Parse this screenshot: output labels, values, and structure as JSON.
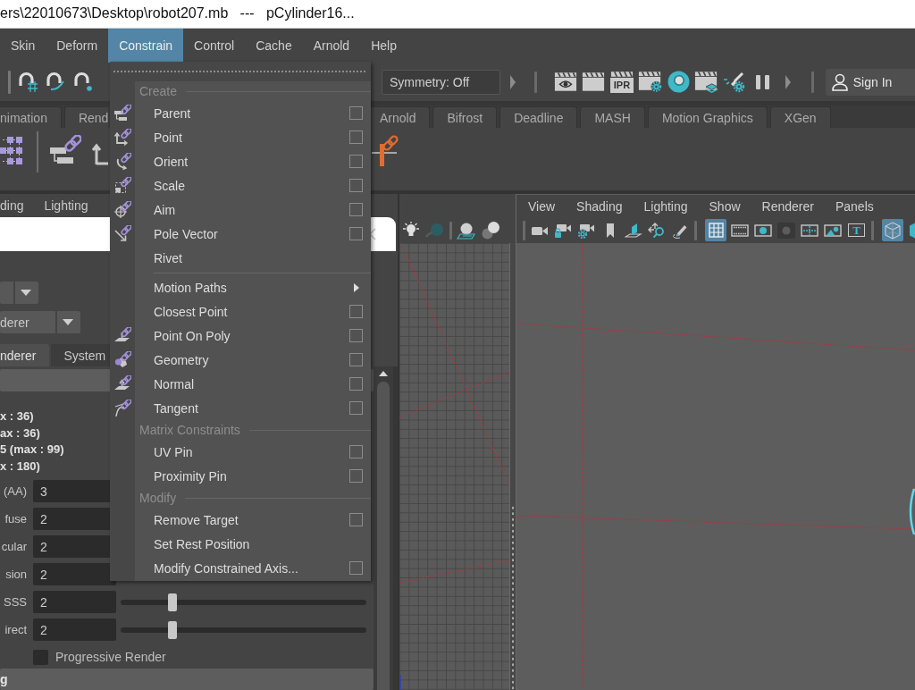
{
  "title_bar": {
    "title": "ers\\22010673\\Desktop\\robot207.mb   ---   pCylinder16..."
  },
  "menu_bar": [
    {
      "label": "Skin",
      "selected": false
    },
    {
      "label": "Deform",
      "selected": false
    },
    {
      "label": "Constrain",
      "selected": true
    },
    {
      "label": "Control",
      "selected": false
    },
    {
      "label": "Cache",
      "selected": false
    },
    {
      "label": "Arnold",
      "selected": false
    },
    {
      "label": "Help",
      "selected": false
    }
  ],
  "status_line": {
    "symmetry": "Symmetry: Off",
    "ipr_label": "IPR",
    "sign_in": "Sign In"
  },
  "shelf_tabs": [
    {
      "label": "nimation",
      "selected": false
    },
    {
      "label": "Rend",
      "selected": false
    },
    {
      "label": "Arnold",
      "selected": false
    },
    {
      "label": "Bifrost",
      "selected": false
    },
    {
      "label": "Deadline",
      "selected": false
    },
    {
      "label": "MASH",
      "selected": false
    },
    {
      "label": "Motion Graphics",
      "selected": false
    },
    {
      "label": "XGen",
      "selected": false
    }
  ],
  "render_panel": {
    "panel_menus": [
      "ding",
      "Lighting"
    ],
    "renderer": "derer",
    "tabs": [
      {
        "label": "nderer",
        "selected": true
      },
      {
        "label": "System",
        "selected": false
      }
    ],
    "info_lines": [
      "x : 36)",
      "ax : 36)",
      "5 (max : 99)",
      "x : 180)"
    ],
    "fields": [
      {
        "label": "(AA)",
        "value": "3"
      },
      {
        "label": "fuse",
        "value": "2"
      },
      {
        "label": "cular",
        "value": "2"
      },
      {
        "label": "sion",
        "value": "2"
      },
      {
        "label": "SSS",
        "value": "2",
        "level": 0.21
      },
      {
        "label": "irect",
        "value": "2",
        "level": 0.21
      }
    ],
    "progressive_render": {
      "label": "Progressive Render",
      "checked": false
    },
    "section_title": "g"
  },
  "model_panel": {
    "panel_menus": [
      "View",
      "Shading",
      "Lighting",
      "Show",
      "Renderer",
      "Panels"
    ],
    "icon_groups": [
      [
        {
          "kind": "camera",
          "on": false
        },
        {
          "kind": "camera_lock",
          "on": false
        },
        {
          "kind": "camera_attributes",
          "on": false
        },
        {
          "kind": "bookmark",
          "on": false
        },
        {
          "kind": "image_plane",
          "on": false
        },
        {
          "kind": "pan_zoom",
          "on": false
        },
        {
          "kind": "grease_pencil",
          "on": false
        }
      ],
      [
        {
          "kind": "grid",
          "on": true
        },
        {
          "kind": "film_gate",
          "on": false
        },
        {
          "kind": "resolution_gate",
          "on": false
        },
        {
          "kind": "gate_mask",
          "on": false
        },
        {
          "kind": "field_chart",
          "on": false
        },
        {
          "kind": "safe_action",
          "on": false
        },
        {
          "kind": "safe_title",
          "on": false,
          "label": "T"
        }
      ],
      [
        {
          "kind": "wireframe",
          "on": true
        },
        {
          "kind": "smooth_shade",
          "on": false
        }
      ]
    ]
  },
  "constrain_menu": {
    "items": [
      {
        "kind": "header",
        "label": "Create"
      },
      {
        "kind": "item",
        "label": "Parent",
        "option_box": true
      },
      {
        "kind": "item",
        "label": "Point",
        "option_box": true
      },
      {
        "kind": "item",
        "label": "Orient",
        "option_box": true
      },
      {
        "kind": "item",
        "label": "Scale",
        "option_box": true
      },
      {
        "kind": "item",
        "label": "Aim",
        "option_box": true
      },
      {
        "kind": "item",
        "label": "Pole Vector",
        "option_box": true
      },
      {
        "kind": "item",
        "label": "Rivet",
        "option_box": false
      },
      {
        "kind": "separator"
      },
      {
        "kind": "item",
        "label": "Motion Paths",
        "option_box": false,
        "submenu": true
      },
      {
        "kind": "item",
        "label": "Closest Point",
        "option_box": true
      },
      {
        "kind": "item",
        "label": "Point On Poly",
        "option_box": true
      },
      {
        "kind": "item",
        "label": "Geometry",
        "option_box": true
      },
      {
        "kind": "item",
        "label": "Normal",
        "option_box": true
      },
      {
        "kind": "item",
        "label": "Tangent",
        "option_box": true
      },
      {
        "kind": "header",
        "label": "Matrix Constraints"
      },
      {
        "kind": "item",
        "label": "UV Pin",
        "option_box": true
      },
      {
        "kind": "item",
        "label": "Proximity Pin",
        "option_box": true
      },
      {
        "kind": "header",
        "label": "Modify"
      },
      {
        "kind": "item",
        "label": "Remove Target",
        "option_box": true
      },
      {
        "kind": "item",
        "label": "Set Rest Position",
        "option_box": false
      },
      {
        "kind": "item",
        "label": "Modify Constrained Axis...",
        "option_box": true
      }
    ]
  }
}
